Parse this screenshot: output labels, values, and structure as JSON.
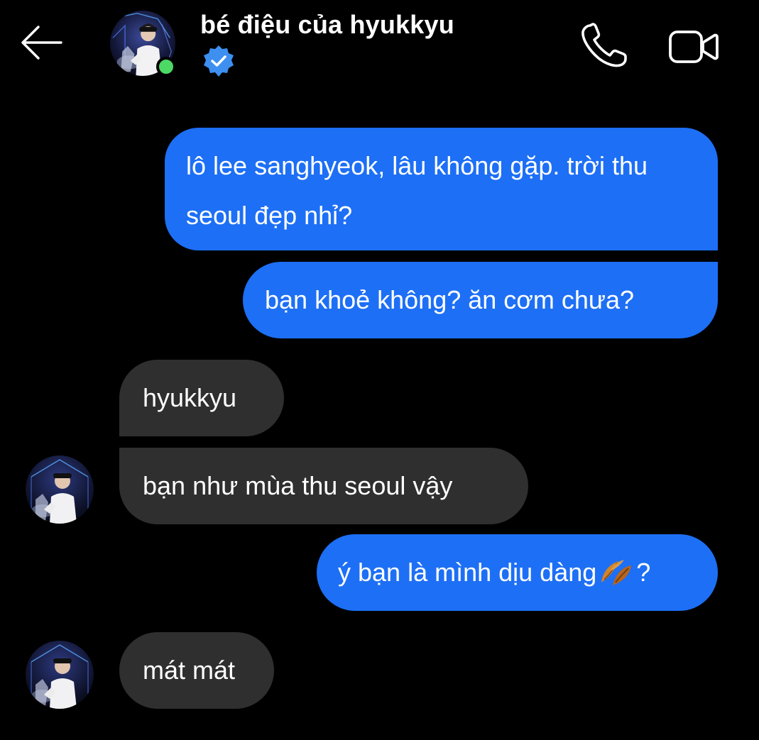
{
  "header": {
    "back_icon": "arrow-left-icon",
    "contact_name": "bé điệu của hyukkyu",
    "verified_icon": "verified-badge-icon",
    "online_status_color": "#4cd964",
    "call_icon": "phone-icon",
    "video_icon": "video-camera-icon"
  },
  "colors": {
    "background": "#000000",
    "sent_bubble": "#1d6ff5",
    "received_bubble": "#2f2f2f",
    "text": "#ffffff",
    "verified": "#3d8ff0"
  },
  "messages": [
    {
      "direction": "sent",
      "text": "lô lee sanghyeok, lâu không gặp. trời thu seoul đẹp nhỉ?"
    },
    {
      "direction": "sent",
      "text": "bạn khoẻ không? ăn cơm chưa?"
    },
    {
      "direction": "received",
      "text": "hyukkyu"
    },
    {
      "direction": "received",
      "text": "bạn như mùa thu seoul vậy"
    },
    {
      "direction": "sent",
      "text_before_emoji": "ý bạn là mình dịu dàng",
      "emoji_icon": "fallen-leaf-icon",
      "text_after_emoji": "?"
    },
    {
      "direction": "received",
      "text": "mát mát"
    }
  ]
}
